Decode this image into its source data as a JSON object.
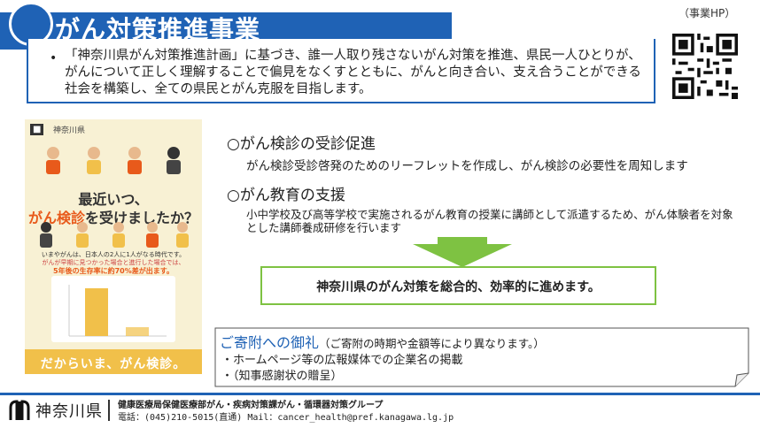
{
  "header": {
    "title": "がん対策推進事業",
    "bullet": "•",
    "summary": "「神奈川県がん対策推進計画」に基づき、誰一人取り残さないがん対策を推進、県民一人ひとりが、がんについて正しく理解することで偏見をなくすとともに、がんと向き合い、支え合うことができる社会を構築し、全ての県民とがん克服を目指します。",
    "qr_label": "（事業HP）"
  },
  "poster": {
    "brand": "神奈川県",
    "headline_line1": "最近いつ、",
    "headline_emph": "がん検診",
    "headline_line2_suffix": "を受けましたか？",
    "small1": "いまやがんは、日本人の2人に1人がなる時代です。",
    "small2": "がんが早期に見つかった場合と進行した場合では、",
    "small3": "5年後の生存率に約70%差が出ます。",
    "footer": "だからいま、がん検診。"
  },
  "content": {
    "item1_heading": "○がん検診の受診促進",
    "item1_text": "がん検診受診啓発のためのリーフレットを作成し、がん検診の必要性を周知します",
    "item2_heading": "○がん教育の支援",
    "item2_text": "小中学校及び高等学校で実施されるがん教育の授業に講師として派遣するため、がん体験者を対象とした講師養成研修を行います",
    "result": "神奈川県のがん対策を総合的、効率的に進めます。"
  },
  "thanks": {
    "title": "ご寄附への御礼",
    "note": "（ご寄附の時期や金額等により異なります。）",
    "item1": "・ホームページ等の広報媒体での企業名の掲載",
    "item2": "・（知事感謝状の贈呈）"
  },
  "footer": {
    "pref": "神奈川県",
    "dept": "健康医療局保健医療部がん・疾病対策課がん・循環器対策グループ",
    "contact": "電話：(045)210-5015(直通) Mail：cancer_health@pref.kanagawa.lg.jp"
  },
  "colors": {
    "brand_blue": "#1f62b5",
    "result_green": "#7ec242",
    "poster_bg": "#f8f1d4",
    "poster_accent": "#f1c04a"
  }
}
